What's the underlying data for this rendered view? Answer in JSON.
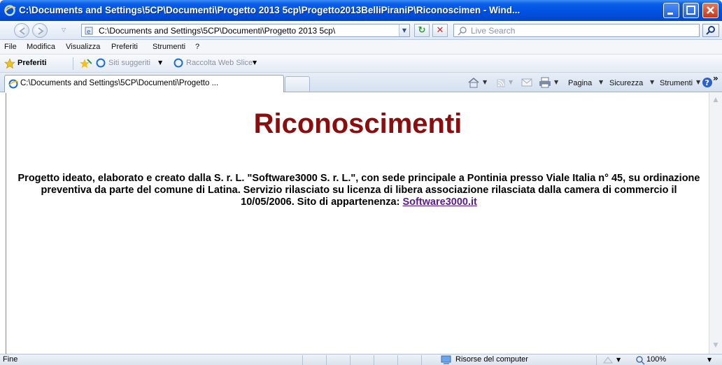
{
  "window": {
    "title": "C:\\Documents and Settings\\5CP\\Documenti\\Progetto 2013 5cp\\Progetto2013BelliPiraniP\\Riconoscimen - Wind..."
  },
  "address_bar": {
    "url": "C:\\Documents and Settings\\5CP\\Documenti\\Progetto 2013 5cp\\",
    "search_placeholder": "Live Search"
  },
  "menu": {
    "items": [
      "File",
      "Modifica",
      "Visualizza",
      "Preferiti",
      "Strumenti",
      "?"
    ]
  },
  "favorites_bar": {
    "favorites_label": "Preferiti",
    "suggested_sites": "Siti suggeriti",
    "web_slice": "Raccolta Web Slice"
  },
  "tab": {
    "label": "C:\\Documents and Settings\\5CP\\Documenti\\Progetto ..."
  },
  "command_bar": {
    "page": "Pagina",
    "security": "Sicurezza",
    "tools": "Strumenti",
    "overflow": "»"
  },
  "content": {
    "heading": "Riconoscimenti",
    "paragraph": "Progetto ideato, elaborato e creato dalla S. r. L. \"Software3000 S. r. L.\", con sede principale a Pontinia presso Viale Italia n° 45, su ordinazione preventiva da parte del comune di Latina. Servizio rilasciato su licenza di libera associazione rilasciata dalla camera di commercio il 10/05/2006. Sito di appartenenza: ",
    "link_text": "Software3000.it"
  },
  "status_bar": {
    "status": "Fine",
    "zone": "Risorse del computer",
    "zoom": "100%"
  },
  "colors": {
    "heading": "#8b0d0d",
    "link": "#5a1a8c",
    "titlebar": "#0050e0"
  }
}
